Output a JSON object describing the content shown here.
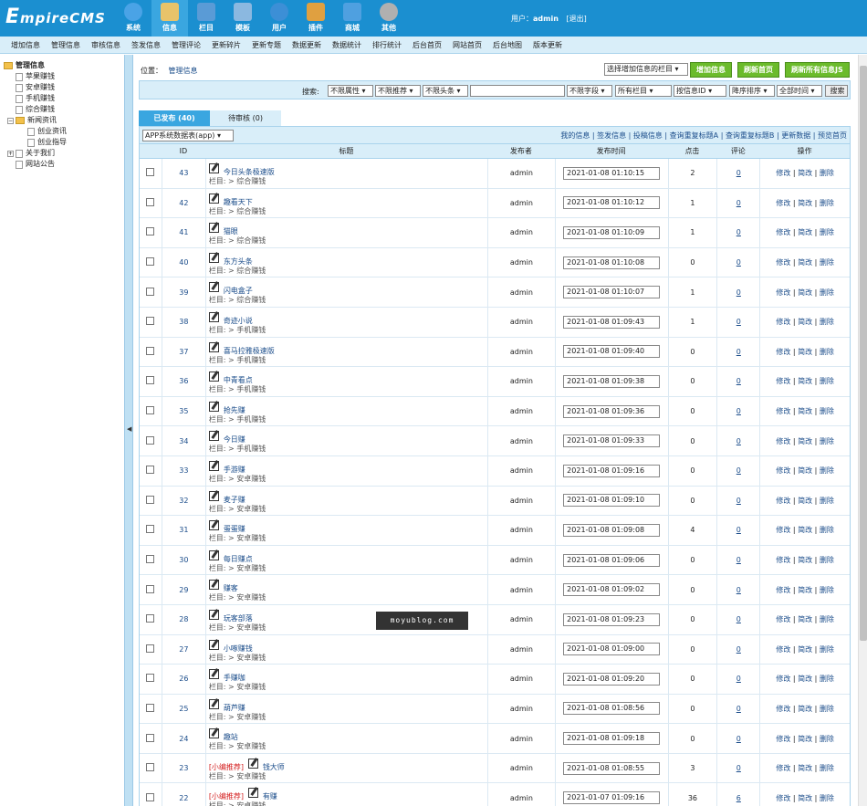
{
  "logo": {
    "part1": "E",
    "part2": "mpire",
    "part3": "CMS"
  },
  "topnav": [
    {
      "label": "系统",
      "icon": "globe-icon",
      "color": "#4aa3e6"
    },
    {
      "label": "信息",
      "icon": "document-edit-icon",
      "color": "#e8c36a"
    },
    {
      "label": "栏目",
      "icon": "folder-icon",
      "color": "#5a9bd6"
    },
    {
      "label": "模板",
      "icon": "template-window-icon",
      "color": "#8bb8e0"
    },
    {
      "label": "用户",
      "icon": "user-icon",
      "color": "#3c8fd6"
    },
    {
      "label": "插件",
      "icon": "tools-icon",
      "color": "#e0a040"
    },
    {
      "label": "商城",
      "icon": "store-card-icon",
      "color": "#4fa0e0"
    },
    {
      "label": "其他",
      "icon": "gear-icon",
      "color": "#b0b0b0"
    }
  ],
  "user": {
    "prefix": "用户：",
    "name": "admin",
    "logout": "[退出]"
  },
  "subnav": [
    "增加信息",
    "管理信息",
    "审核信息",
    "签发信息",
    "管理评论",
    "更新碎片",
    "更新专题",
    "数据更新",
    "数据统计",
    "排行统计",
    "后台首页",
    "网站首页",
    "后台地图",
    "版本更新"
  ],
  "tree": {
    "root": "管理信息",
    "items": [
      "苹果赚钱",
      "安卓赚钱",
      "手机赚钱",
      "综合赚钱"
    ],
    "group": "新闻资讯",
    "group_items": [
      "创业资讯",
      "创业指导"
    ],
    "group2": "关于我们",
    "last": "网站公告"
  },
  "location": {
    "label": "位置：",
    "value": "管理信息"
  },
  "toolbar": {
    "select_column": "选择增加信息的栏目",
    "add": "增加信息",
    "refresh_home": "刷新首页",
    "refresh_all_js": "刷新所有信息JS"
  },
  "search": {
    "label": "搜索:",
    "attr": "不限属性",
    "recommend": "不限推荐",
    "headline": "不限头条",
    "keyword": "",
    "field": "不限字段",
    "column": "所有栏目",
    "order_by": "按信息ID",
    "order": "降序排序",
    "time": "全部时间",
    "button": "搜索"
  },
  "tabs": {
    "published": "已发布 (40)",
    "pending": "待审核 (0)"
  },
  "table": {
    "select": "APP系统数据表(app)",
    "links": [
      "我的信息",
      "签发信息",
      "投稿信息",
      "查询重复标题A",
      "查询重复标题B",
      "更新数据",
      "预览首页"
    ],
    "headers": [
      "ID",
      "标题",
      "发布者",
      "发布时间",
      "点击",
      "评论",
      "操作"
    ],
    "col_prefix": "栏目: > ",
    "ops": [
      "修改",
      "简改",
      "删除"
    ],
    "rows": [
      {
        "id": "43",
        "title": "今日头条极速版",
        "cat": "综合赚钱",
        "user": "admin",
        "time": "2021-01-08 01:10:15",
        "clicks": "2",
        "comments": "0",
        "rec": ""
      },
      {
        "id": "42",
        "title": "趣看天下",
        "cat": "综合赚钱",
        "user": "admin",
        "time": "2021-01-08 01:10:12",
        "clicks": "1",
        "comments": "0",
        "rec": ""
      },
      {
        "id": "41",
        "title": "猫眼",
        "cat": "综合赚钱",
        "user": "admin",
        "time": "2021-01-08 01:10:09",
        "clicks": "1",
        "comments": "0",
        "rec": ""
      },
      {
        "id": "40",
        "title": "东方头条",
        "cat": "综合赚钱",
        "user": "admin",
        "time": "2021-01-08 01:10:08",
        "clicks": "0",
        "comments": "0",
        "rec": ""
      },
      {
        "id": "39",
        "title": "闪电盒子",
        "cat": "综合赚钱",
        "user": "admin",
        "time": "2021-01-08 01:10:07",
        "clicks": "1",
        "comments": "0",
        "rec": ""
      },
      {
        "id": "38",
        "title": "奇迹小说",
        "cat": "手机赚钱",
        "user": "admin",
        "time": "2021-01-08 01:09:43",
        "clicks": "1",
        "comments": "0",
        "rec": ""
      },
      {
        "id": "37",
        "title": "喜马拉雅极速版",
        "cat": "手机赚钱",
        "user": "admin",
        "time": "2021-01-08 01:09:40",
        "clicks": "0",
        "comments": "0",
        "rec": ""
      },
      {
        "id": "36",
        "title": "中青看点",
        "cat": "手机赚钱",
        "user": "admin",
        "time": "2021-01-08 01:09:38",
        "clicks": "0",
        "comments": "0",
        "rec": ""
      },
      {
        "id": "35",
        "title": "抢先赚",
        "cat": "手机赚钱",
        "user": "admin",
        "time": "2021-01-08 01:09:36",
        "clicks": "0",
        "comments": "0",
        "rec": ""
      },
      {
        "id": "34",
        "title": "今日赚",
        "cat": "手机赚钱",
        "user": "admin",
        "time": "2021-01-08 01:09:33",
        "clicks": "0",
        "comments": "0",
        "rec": ""
      },
      {
        "id": "33",
        "title": "手游赚",
        "cat": "安卓赚钱",
        "user": "admin",
        "time": "2021-01-08 01:09:16",
        "clicks": "0",
        "comments": "0",
        "rec": ""
      },
      {
        "id": "32",
        "title": "麦子赚",
        "cat": "安卓赚钱",
        "user": "admin",
        "time": "2021-01-08 01:09:10",
        "clicks": "0",
        "comments": "0",
        "rec": ""
      },
      {
        "id": "31",
        "title": "蛋蛋赚",
        "cat": "安卓赚钱",
        "user": "admin",
        "time": "2021-01-08 01:09:08",
        "clicks": "4",
        "comments": "0",
        "rec": ""
      },
      {
        "id": "30",
        "title": "每日赚点",
        "cat": "安卓赚钱",
        "user": "admin",
        "time": "2021-01-08 01:09:06",
        "clicks": "0",
        "comments": "0",
        "rec": ""
      },
      {
        "id": "29",
        "title": "赚客",
        "cat": "安卓赚钱",
        "user": "admin",
        "time": "2021-01-08 01:09:02",
        "clicks": "0",
        "comments": "0",
        "rec": ""
      },
      {
        "id": "28",
        "title": "玩客部落",
        "cat": "安卓赚钱",
        "user": "admin",
        "time": "2021-01-08 01:09:23",
        "clicks": "0",
        "comments": "0",
        "rec": ""
      },
      {
        "id": "27",
        "title": "小啄赚钱",
        "cat": "安卓赚钱",
        "user": "admin",
        "time": "2021-01-08 01:09:00",
        "clicks": "0",
        "comments": "0",
        "rec": ""
      },
      {
        "id": "26",
        "title": "手赚咖",
        "cat": "安卓赚钱",
        "user": "admin",
        "time": "2021-01-08 01:09:20",
        "clicks": "0",
        "comments": "0",
        "rec": ""
      },
      {
        "id": "25",
        "title": "葫芦赚",
        "cat": "安卓赚钱",
        "user": "admin",
        "time": "2021-01-08 01:08:56",
        "clicks": "0",
        "comments": "0",
        "rec": ""
      },
      {
        "id": "24",
        "title": "趣站",
        "cat": "安卓赚钱",
        "user": "admin",
        "time": "2021-01-08 01:09:18",
        "clicks": "0",
        "comments": "0",
        "rec": ""
      },
      {
        "id": "23",
        "title": "钱大师",
        "cat": "安卓赚钱",
        "user": "admin",
        "time": "2021-01-08 01:08:55",
        "clicks": "3",
        "comments": "0",
        "rec": "[小编推荐]"
      },
      {
        "id": "22",
        "title": "有赚",
        "cat": "安卓赚钱",
        "user": "admin",
        "time": "2021-01-07 01:09:16",
        "clicks": "36",
        "comments": "6",
        "rec": "[小编推荐]"
      }
    ]
  },
  "watermark": "moyublog.com"
}
